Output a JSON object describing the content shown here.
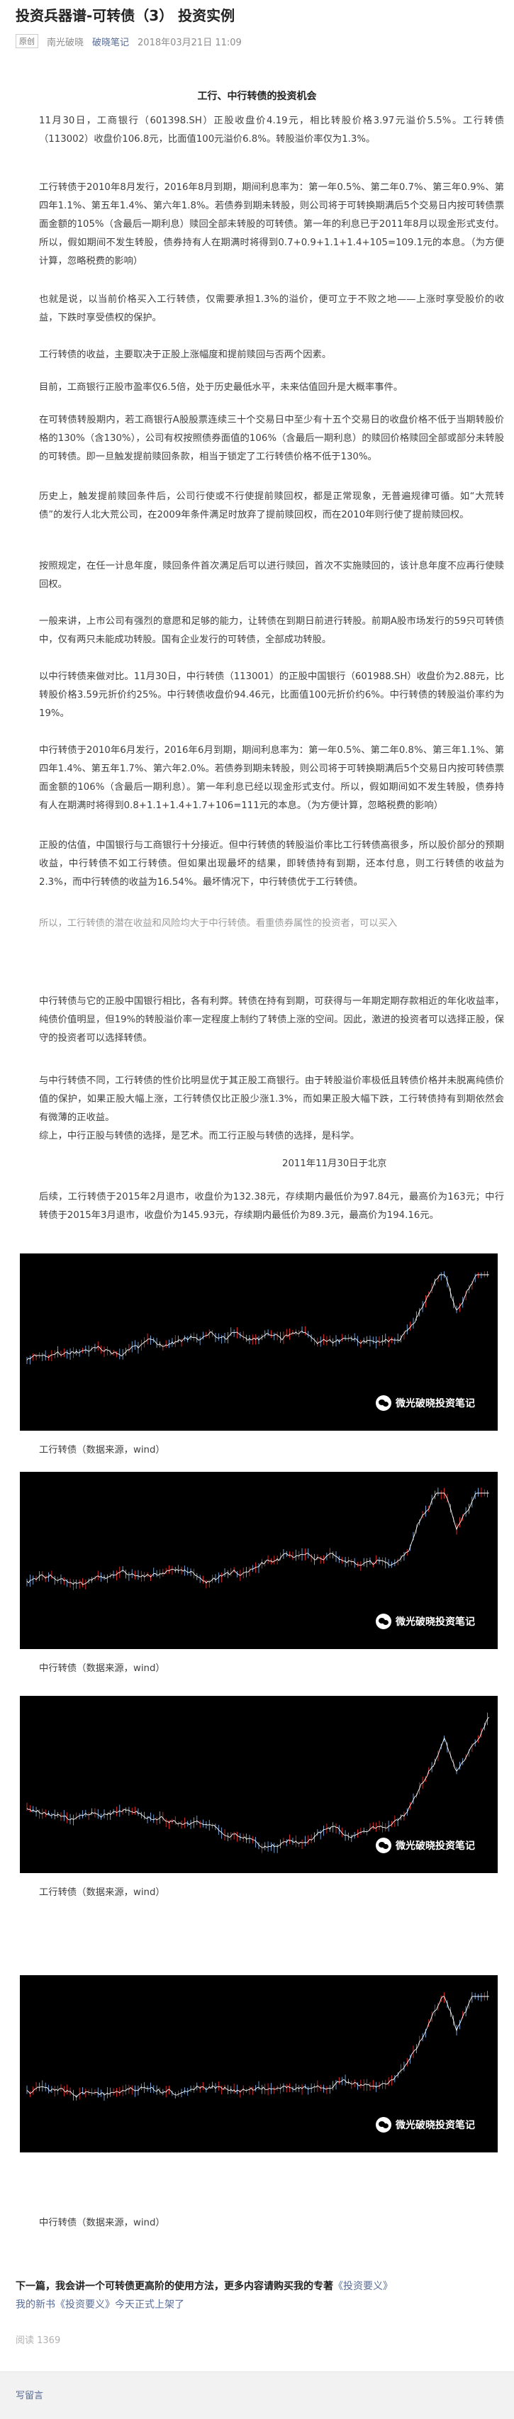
{
  "article": {
    "title": "投资兵器谱-可转债（3） 投资实例",
    "tag": "原创",
    "author": "南光破晓",
    "account": "破晓笔记",
    "date": "2018年03月21日 11:09"
  },
  "section_title": "工行、中行转债的投资机会",
  "paragraphs": [
    "11月30日，工商银行（601398.SH）正股收盘价4.19元，相比转股价格3.97元溢价5.5%。工行转债（113002）收盘价106.8元，比面值100元溢价6.8%。转股溢价率仅为1.3%。",
    "工行转债于2010年8月发行，2016年8月到期，期间利息率为：第一年0.5%、第二年0.7%、第三年0.9%、第四年1.1%、第五年1.4%、第六年1.8%。若债券到期未转股，则公司将于可转换期满后5个交易日内按可转债票面金额的105%（含最后一期利息）赎回全部未转股的可转债。第一年的利息已于2011年8月以现金形式支付。所以，假如期间不发生转股，债券持有人在期满时将得到0.7+0.9+1.1+1.4+105=109.1元的本息。（为方便计算，忽略税费的影响）",
    "也就是说，以当前价格买入工行转债，仅需要承担1.3%的溢价，便可立于不败之地——上涨时享受股价的收益，下跌时享受债权的保护。",
    "工行转债的收益，主要取决于正股上涨幅度和提前赎回与否两个因素。",
    "目前，工商银行正股市盈率仅6.5倍，处于历史最低水平，未来估值回升是大概率事件。",
    "在可转债转股期内，若工商银行A股股票连续三十个交易日中至少有十五个交易日的收盘价格不低于当期转股价格的130%（含130%），公司有权按照债券面值的106%（含最后一期利息）的赎回价格赎回全部或部分未转股的可转债。即一旦触发提前赎回条款，相当于锁定了工行转债价格不低于130%。",
    "历史上，触发提前赎回条件后，公司行使或不行使提前赎回权，都是正常现象，无普遍规律可循。如“大荒转债”的发行人北大荒公司，在2009年条件满足时放弃了提前赎回权，而在2010年则行使了提前赎回权。",
    "按照规定，在任一计息年度，赎回条件首次满足后可以进行赎回，首次不实施赎回的，该计息年度不应再行使赎回权。",
    "一般来讲，上市公司有强烈的意愿和足够的能力，让转债在到期日前进行转股。前期A股市场发行的59只可转债中，仅有两只未能成功转股。国有企业发行的可转债，全部成功转股。",
    "以中行转债来做对比。11月30日，中行转债（113001）的正股中国银行（601988.SH）收盘价为2.88元，比转股价格3.59元折价约25%。中行转债收盘价94.46元，比面值100元折价约6%。中行转债的转股溢价率约为19%。",
    "中行转债于2010年6月发行，2016年6月到期，期间利息率为：第一年0.5%、第二年0.8%、第三年1.1%、第四年1.4%、第五年1.7%、第六年2.0%。若债券到期未转股，则公司将于可转换期满后5个交易日内按可转债票面金额的106%（含最后一期利息）。第一年利息已经以现金形式支付。所以，假如期间如不发生转股，债券持有人在期满时将得到0.8+1.1+1.4+1.7+106=111元的本息。（为方便计算，忽略税费的影响）",
    "正股的估值，中国银行与工商银行十分接近。但中行转债的转股溢价率比工行转债高很多，所以股价部分的预期收益，中行转债不如工行转债。但如果出现最坏的结果，即转债持有到期，还本付息，则工行转债的收益为2.3%，而中行转债的收益为16.54%。最坏情况下，中行转债优于工行转债。",
    "所以，工行转债的潜在收益和风险均大于中行转债。看重债券属性的投资者，可以买入",
    "中行转债与它的正股中国银行相比，各有利弊。转债在持有到期，可获得与一年期定期存款相近的年化收益率，纯债价值明显，但19%的转股溢价率一定程度上制约了转债上涨的空间。因此，激进的投资者可以选择正股，保守的投资者可以选择转债。",
    "与中行转债不同，工行转债的性价比明显优于其正股工商银行。由于转股溢价率极低且转债价格并未脱离纯债价值的保护，如果正股大幅上涨，工行转债仅比正股少涨1.3%，而如果正股大幅下跌，工行转债持有到期依然会有微薄的正收益。",
    "综上，中行正股与转债的选择，是艺术。而工行正股与转债的选择，是科学。"
  ],
  "signature": "2011年11月30日于北京",
  "postscript": "后续，工行转债于2015年2月退市，收盘价为132.38元，存续期内最低价为97.84元，最高价为163元；中行转债于2015年3月退市，收盘价为145.93元，存续期内最低价为89.3元，最高价为194.16元。",
  "watermark": "微光破晓投资笔记",
  "captions": [
    "工行转债（数据来源，wind）",
    "中行转债（数据来源，wind）",
    "工行转债（数据来源，wind）",
    "中行转债（数据来源，wind）"
  ],
  "footer": {
    "prefix": "下一篇，我会讲一个可转债更高阶的使用方法，更多内容请购买我的专著",
    "book_link": "《投资要义》",
    "link2": "我的新书《投资要义》今天正式上架了"
  },
  "read_count": "阅读 1369",
  "comment_prompt": "写留言",
  "colors": {
    "link": "#576b95",
    "chart_bg": "#000000",
    "line": "#ffffff",
    "accent": "#ff3333"
  }
}
